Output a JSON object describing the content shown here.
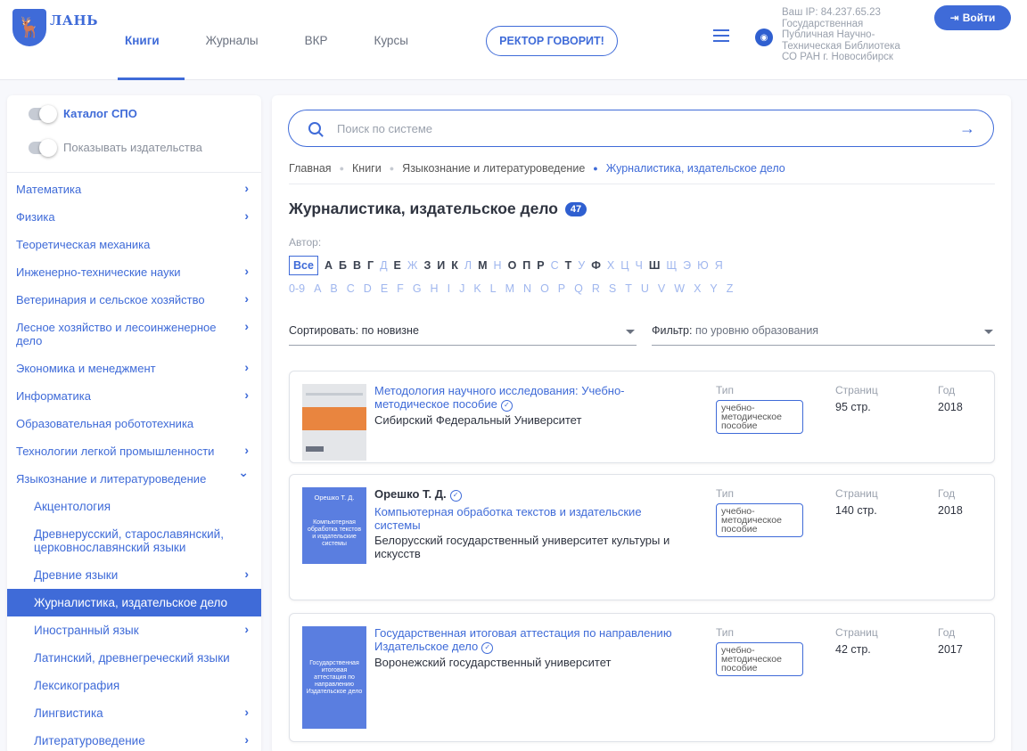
{
  "header": {
    "logo_text": "ЛАНЬ",
    "nav": [
      "Книги",
      "Журналы",
      "ВКР",
      "Курсы"
    ],
    "rector": "РЕКТОР ГОВОРИТ!",
    "ip_lines": [
      "Ваш IP: 84.237.65.23",
      "Государственная",
      "Публичная Научно-",
      "Техническая Библиотека",
      "СО РАН г. Новосибирск"
    ],
    "login": "Войти"
  },
  "sidebar": {
    "toggle_spo": "Каталог СПО",
    "toggle_publishers": "Показывать издательства",
    "categories": [
      {
        "label": "Математика",
        "chevron": true
      },
      {
        "label": "Физика",
        "chevron": true
      },
      {
        "label": "Теоретическая механика",
        "chevron": false
      },
      {
        "label": "Инженерно-технические науки",
        "chevron": true
      },
      {
        "label": "Ветеринария и сельское хозяйство",
        "chevron": true
      },
      {
        "label": "Лесное хозяйство и лесоинженерное дело",
        "chevron": true
      },
      {
        "label": "Экономика и менеджмент",
        "chevron": true
      },
      {
        "label": "Информатика",
        "chevron": true
      },
      {
        "label": "Образовательная робототехника",
        "chevron": false
      },
      {
        "label": "Технологии легкой промышленности",
        "chevron": true
      },
      {
        "label": "Языкознание и литературоведение",
        "chevron": true,
        "expanded": true
      },
      {
        "label": "Акцентология",
        "sub": true
      },
      {
        "label": "Древнерусский, старославянский, церковнославянский языки",
        "sub": true
      },
      {
        "label": "Древние языки",
        "sub": true,
        "chevron": true
      },
      {
        "label": "Журналистика, издательское дело",
        "sub": true,
        "active": true
      },
      {
        "label": "Иностранный язык",
        "sub": true,
        "chevron": true
      },
      {
        "label": "Латинский, древнегреческий языки",
        "sub": true
      },
      {
        "label": "Лексикография",
        "sub": true
      },
      {
        "label": "Лингвистика",
        "sub": true,
        "chevron": true
      },
      {
        "label": "Литературоведение",
        "sub": true,
        "chevron": true
      }
    ]
  },
  "search": {
    "placeholder": "Поиск по системе"
  },
  "breadcrumb": [
    "Главная",
    "Книги",
    "Языкознание и литературоведение",
    "Журналистика, издательское дело"
  ],
  "page": {
    "title": "Журналистика, издательское дело",
    "count": "47"
  },
  "author_label": "Автор:",
  "alphabet_ru": [
    {
      "c": "Все",
      "all": true
    },
    {
      "c": "А",
      "b": true
    },
    {
      "c": "Б",
      "b": true
    },
    {
      "c": "В",
      "b": true
    },
    {
      "c": "Г",
      "b": true
    },
    {
      "c": "Д"
    },
    {
      "c": "Е",
      "b": true
    },
    {
      "c": "Ж"
    },
    {
      "c": "З",
      "b": true
    },
    {
      "c": "И",
      "b": true
    },
    {
      "c": "К",
      "b": true
    },
    {
      "c": "Л"
    },
    {
      "c": "М",
      "b": true
    },
    {
      "c": "Н"
    },
    {
      "c": "О",
      "b": true
    },
    {
      "c": "П",
      "b": true
    },
    {
      "c": "Р",
      "b": true
    },
    {
      "c": "С"
    },
    {
      "c": "Т",
      "b": true
    },
    {
      "c": "У"
    },
    {
      "c": "Ф",
      "b": true
    },
    {
      "c": "Х"
    },
    {
      "c": "Ц"
    },
    {
      "c": "Ч"
    },
    {
      "c": "Ш",
      "b": true
    },
    {
      "c": "Щ"
    },
    {
      "c": "Э"
    },
    {
      "c": "Ю"
    },
    {
      "c": "Я"
    }
  ],
  "alphabet_lat": [
    "0-9",
    "A",
    "B",
    "C",
    "D",
    "E",
    "F",
    "G",
    "H",
    "I",
    "J",
    "K",
    "L",
    "M",
    "N",
    "O",
    "P",
    "Q",
    "R",
    "S",
    "T",
    "U",
    "V",
    "W",
    "X",
    "Y",
    "Z"
  ],
  "sort": {
    "label": "Сортировать:",
    "value": "по новизне"
  },
  "filter": {
    "label": "Фильтр:",
    "value": "по уровню образования"
  },
  "meta_labels": {
    "type": "Тип",
    "pages": "Страниц",
    "year": "Год"
  },
  "books": [
    {
      "author": "",
      "title": "Методология научного исследования: Учебно-методическое пособие",
      "publisher": "Сибирский Федеральный Университет",
      "type": "учебно-методическое пособие",
      "pages": "95 стр.",
      "year": "2018",
      "cover": "gray",
      "cover_author": "",
      "cover_title": ""
    },
    {
      "author": "Орешко Т. Д.",
      "title": "Компьютерная обработка текстов и издательские системы",
      "publisher": "Белорусский государственный университет культуры и искусств",
      "type": "учебно-методическое пособие",
      "pages": "140 стр.",
      "year": "2018",
      "cover": "blue",
      "cover_author": "Орешко Т. Д.",
      "cover_title": "Компьютерная обработка текстов и издательские системы"
    },
    {
      "author": "",
      "title": "Государственная итоговая аттестация по направлению Издательское дело",
      "publisher": "Воронежский государственный университет",
      "type": "учебно-методическое пособие",
      "pages": "42 стр.",
      "year": "2017",
      "cover": "blue",
      "cover_author": "",
      "cover_title": "Государственная итоговая аттестация по направлению Издательское дело"
    }
  ]
}
